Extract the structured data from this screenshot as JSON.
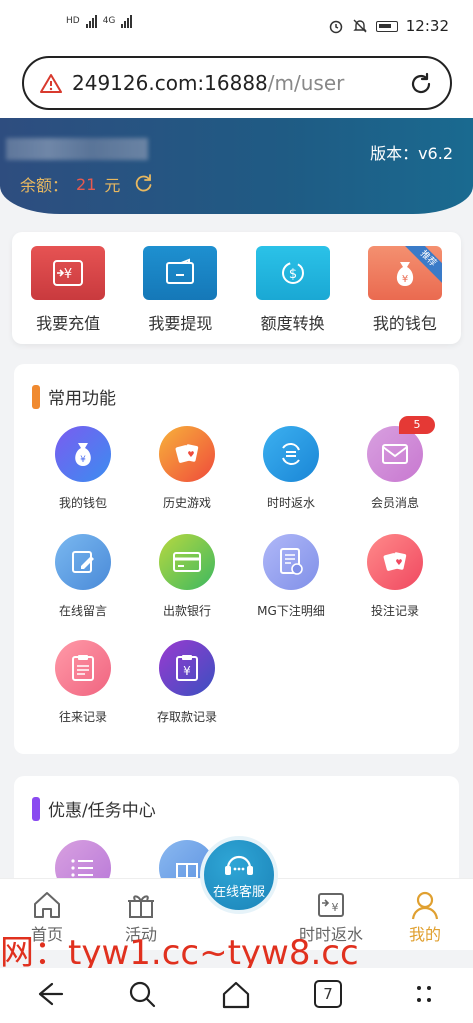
{
  "status_bar": {
    "time": "12:32",
    "left_labels": [
      "HD",
      "4G",
      "4G"
    ]
  },
  "browser": {
    "url_host": "249126.com:16888",
    "url_path": "/m/user"
  },
  "header": {
    "version_label": "版本：v6.2",
    "balance_label": "余额：",
    "balance_amount": "21",
    "balance_unit": "元"
  },
  "quick_actions": [
    {
      "label": "我要充值",
      "icon": "recharge-icon",
      "color": "#e0474b"
    },
    {
      "label": "我要提现",
      "icon": "wallet-icon",
      "color": "#1e87c8"
    },
    {
      "label": "额度转换",
      "icon": "transfer-icon",
      "color": "#21b4de"
    },
    {
      "label": "我的钱包",
      "icon": "money-bag-icon",
      "color": "#f08060",
      "ribbon": "推荐"
    }
  ],
  "common_functions": {
    "title": "常用功能",
    "items": [
      {
        "label": "我的钱包",
        "icon": "money-bag-icon"
      },
      {
        "label": "历史游戏",
        "icon": "cards-icon"
      },
      {
        "label": "时时返水",
        "icon": "refresh-icon"
      },
      {
        "label": "会员消息",
        "icon": "mail-icon",
        "badge": "5"
      },
      {
        "label": "在线留言",
        "icon": "edit-icon"
      },
      {
        "label": "出款银行",
        "icon": "card-icon"
      },
      {
        "label": "MG下注明细",
        "icon": "document-icon"
      },
      {
        "label": "投注记录",
        "icon": "cards-icon"
      },
      {
        "label": "往来记录",
        "icon": "clipboard-icon"
      },
      {
        "label": "存取款记录",
        "icon": "clipboard-yen-icon"
      }
    ]
  },
  "promo_center": {
    "title": "优惠/任务中心"
  },
  "tabbar": {
    "home": "首页",
    "activity": "活动",
    "service": "在线客服",
    "rebate": "时时返水",
    "mine": "我的"
  },
  "watermark": "网：tyw1.cc~tyw8.cc",
  "navbar": {
    "tabs_count": "7"
  },
  "colors": {
    "header_bg": "#1f5b84",
    "accent": "#e0a030",
    "badge": "#e53935"
  }
}
